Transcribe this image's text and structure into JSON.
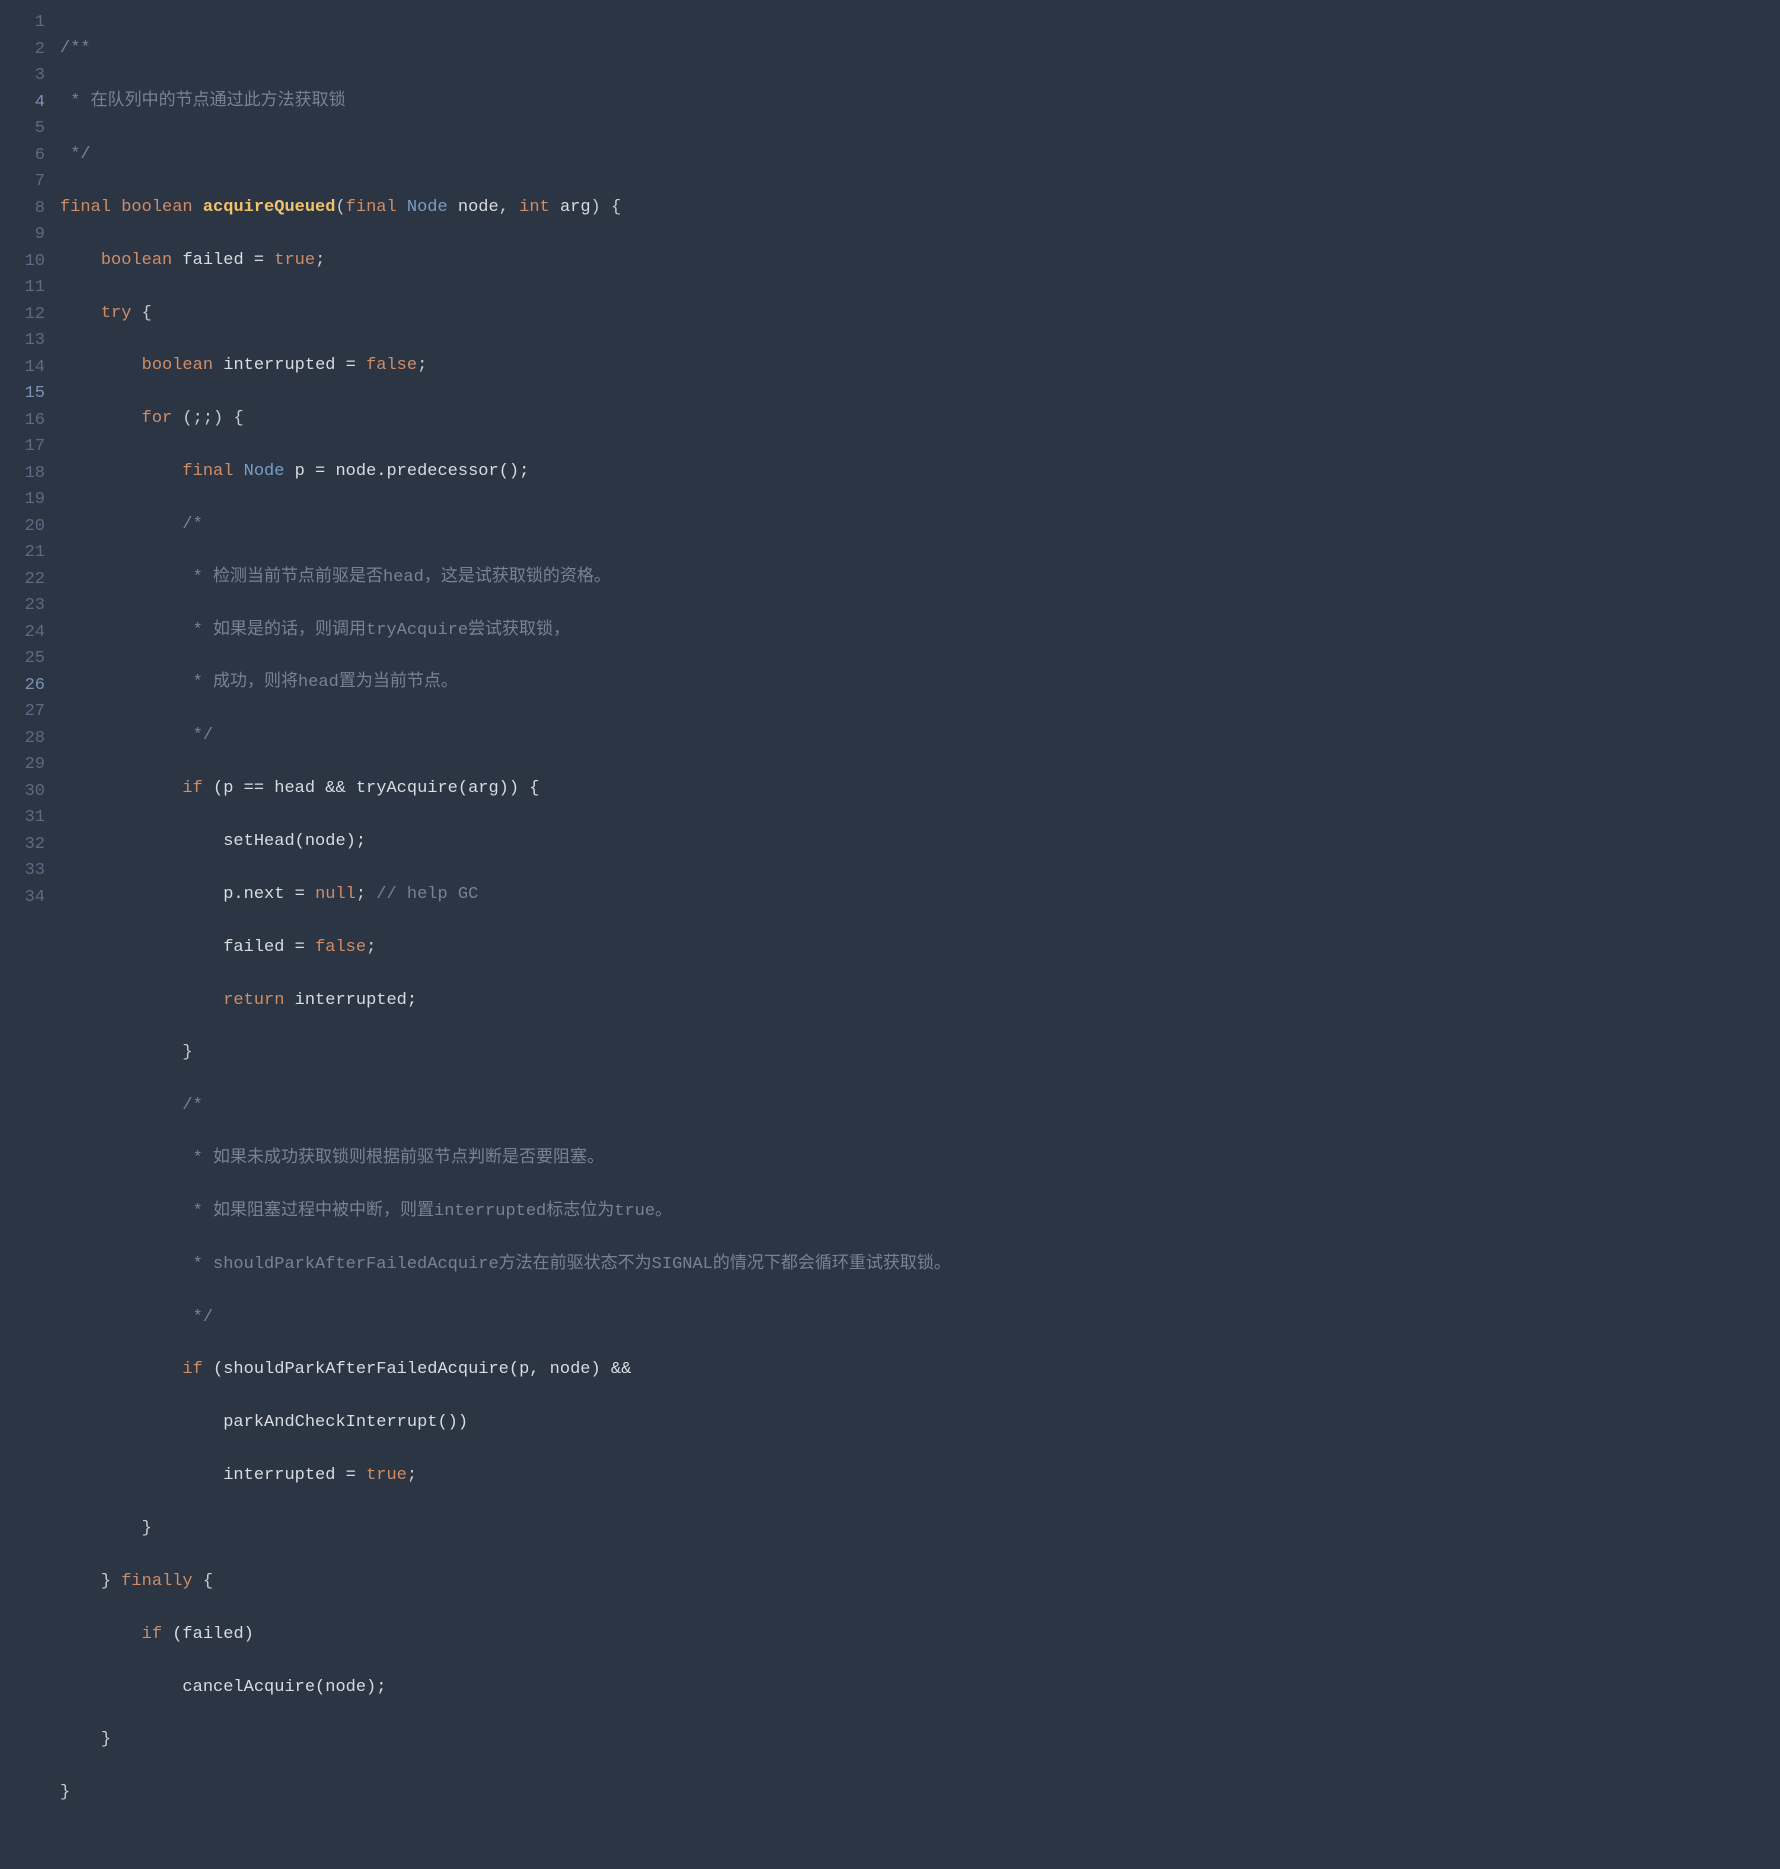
{
  "lineNumbers": [
    "1",
    "2",
    "3",
    "4",
    "5",
    "6",
    "7",
    "8",
    "9",
    "10",
    "11",
    "12",
    "13",
    "14",
    "15",
    "16",
    "17",
    "18",
    "19",
    "20",
    "21",
    "22",
    "23",
    "24",
    "25",
    "26",
    "27",
    "28",
    "29",
    "30",
    "31",
    "32",
    "33",
    "34"
  ],
  "highlightedLines": [
    4,
    15,
    26
  ],
  "tokens": {
    "l1": {
      "comment": "/**"
    },
    "l2": {
      "comment": " * 在队列中的节点通过此方法获取锁"
    },
    "l3": {
      "comment": " */"
    },
    "l4": {
      "kw_final": "final",
      "kw_boolean": "boolean",
      "method": "acquireQueued",
      "paren_open": "(",
      "kw_final2": "final",
      "type_node": "Node",
      "param_node": "node",
      "comma": ", ",
      "kw_int": "int",
      "param_arg": "arg",
      "paren_close": ") {"
    },
    "l5": {
      "kw_boolean": "boolean",
      "id_failed": "failed = ",
      "kw_true": "true",
      "semi": ";"
    },
    "l6": {
      "kw_try": "try",
      "brace": " {"
    },
    "l7": {
      "kw_boolean": "boolean",
      "id_interrupted": "interrupted = ",
      "kw_false": "false",
      "semi": ";"
    },
    "l8": {
      "kw_for": "for",
      "cond": " (;;) {"
    },
    "l9": {
      "kw_final": "final",
      "type_node": "Node",
      "id_p": "p = node.predecessor();"
    },
    "l10": {
      "comment": "/*"
    },
    "l11": {
      "comment": " * 检测当前节点前驱是否head，这是试获取锁的资格。"
    },
    "l12": {
      "comment": " * 如果是的话，则调用tryAcquire尝试获取锁，"
    },
    "l13": {
      "comment": " * 成功，则将head置为当前节点。"
    },
    "l14": {
      "comment": " */"
    },
    "l15": {
      "kw_if": "if",
      "cond": " (p == head && tryAcquire(arg)) {"
    },
    "l16": {
      "call": "setHead(node);"
    },
    "l17": {
      "stmt": "p.next = ",
      "kw_null": "null",
      "semi": ";",
      "comment": " // help GC"
    },
    "l18": {
      "stmt": "failed = ",
      "kw_false": "false",
      "semi": ";"
    },
    "l19": {
      "kw_return": "return",
      "id": " interrupted;"
    },
    "l20": {
      "brace": "}"
    },
    "l21": {
      "comment": "/*"
    },
    "l22": {
      "comment": " * 如果未成功获取锁则根据前驱节点判断是否要阻塞。"
    },
    "l23": {
      "comment": " * 如果阻塞过程中被中断，则置interrupted标志位为true。"
    },
    "l24": {
      "comment": " * shouldParkAfterFailedAcquire方法在前驱状态不为SIGNAL的情况下都会循环重试获取锁。"
    },
    "l25": {
      "comment": " */"
    },
    "l26": {
      "kw_if": "if",
      "cond": " (shouldParkAfterFailedAcquire(p, node) &&"
    },
    "l27": {
      "call": "parkAndCheckInterrupt())"
    },
    "l28": {
      "stmt": "interrupted = ",
      "kw_true": "true",
      "semi": ";"
    },
    "l29": {
      "brace": "}"
    },
    "l30": {
      "close": "} ",
      "kw_finally": "finally",
      "brace": " {"
    },
    "l31": {
      "kw_if": "if",
      "cond": " (failed)"
    },
    "l32": {
      "call": "cancelAcquire(node);"
    },
    "l33": {
      "brace": "}"
    },
    "l34": {
      "brace": "}"
    }
  }
}
